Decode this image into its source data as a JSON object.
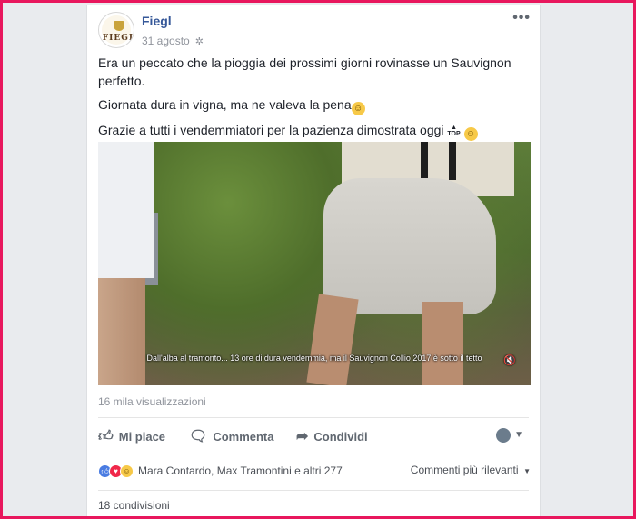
{
  "post": {
    "page_name": "Fiegl",
    "date": "31 agosto",
    "avatar_text": "FIEGL",
    "privacy_icon": "globe-icon",
    "more_label": "•••",
    "paragraphs": [
      "Era un peccato che la pioggia dei prossimi giorni rovinasse un Sauvignon perfetto.",
      "Giornata dura in vigna, ma ne valeva la pena",
      "Grazie a tutti i vendemmiatori per la pazienza dimostrata oggi"
    ]
  },
  "video": {
    "caption": "Dall'alba al tramonto... 13 ore di dura vendemmia, ma il Sauvignon Collio 2017 è sotto il tetto",
    "views": "16 mila visualizzazioni"
  },
  "actions": {
    "like": "Mi piace",
    "comment": "Commenta",
    "share": "Condividi"
  },
  "reactions": {
    "names": "Mara Contardo, Max Tramontini e altri 277",
    "sort_label": "Commenti più rilevanti"
  },
  "shares": "18 condivisioni",
  "colors": {
    "frame": "#e8175d",
    "link": "#365899",
    "like": "#4a7ce2",
    "love": "#f0284a",
    "haha": "#f7c948"
  }
}
